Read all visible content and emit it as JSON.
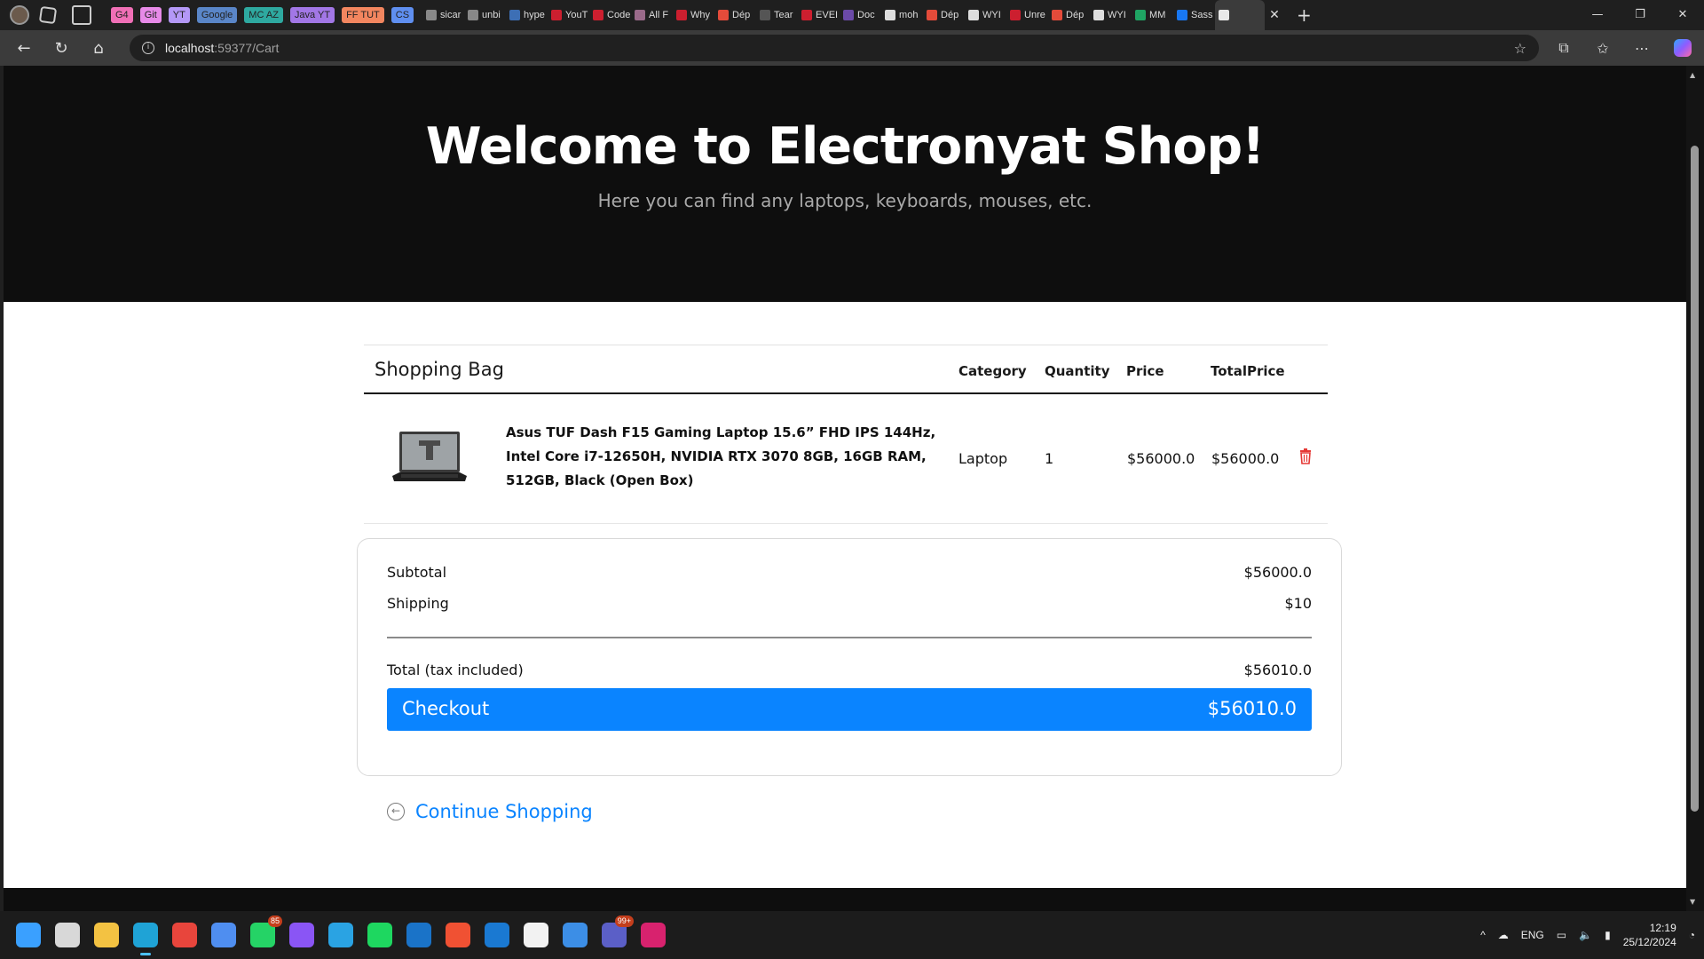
{
  "browser": {
    "tab_groups": [
      {
        "label": "G4",
        "color": "#f06fb6"
      },
      {
        "label": "Git",
        "color": "#e78ae8"
      },
      {
        "label": "YT",
        "color": "#b498f7"
      },
      {
        "label": "Google",
        "color": "#5a86c8"
      },
      {
        "label": "MC AZ",
        "color": "#2ea9a0"
      },
      {
        "label": "Java YT",
        "color": "#a277e6"
      },
      {
        "label": "FF TUT",
        "color": "#f2865f"
      },
      {
        "label": "CS",
        "color": "#5f8ff0"
      }
    ],
    "tabs": [
      {
        "title": "sicar",
        "favicon_color": "#888888"
      },
      {
        "title": "unbi",
        "favicon_color": "#888888"
      },
      {
        "title": "hype",
        "favicon_color": "#3d6fb5"
      },
      {
        "title": "YouT",
        "favicon_color": "#cc1f2f"
      },
      {
        "title": "Code",
        "favicon_color": "#cc1f2f"
      },
      {
        "title": "All F",
        "favicon_color": "#9a6a8a"
      },
      {
        "title": "Why",
        "favicon_color": "#cc1f2f"
      },
      {
        "title": "Dép",
        "favicon_color": "#e44b3a"
      },
      {
        "title": "Tear",
        "favicon_color": "#555555"
      },
      {
        "title": "EVEI",
        "favicon_color": "#cc1f2f"
      },
      {
        "title": "Doc",
        "favicon_color": "#6b4aa8"
      },
      {
        "title": "moh",
        "favicon_color": "#dddddd"
      },
      {
        "title": "Dép",
        "favicon_color": "#e44b3a"
      },
      {
        "title": "WYI",
        "favicon_color": "#dddddd"
      },
      {
        "title": "Unre",
        "favicon_color": "#cc1f2f"
      },
      {
        "title": "Dép",
        "favicon_color": "#e44b3a"
      },
      {
        "title": "WYI",
        "favicon_color": "#dddddd"
      },
      {
        "title": "MM",
        "favicon_color": "#1fa463"
      },
      {
        "title": "Sass",
        "favicon_color": "#1877f2"
      },
      {
        "title": "",
        "favicon_color": "#e8e8e8"
      }
    ],
    "url_host": "localhost",
    "url_path": ":59377/Cart"
  },
  "hero": {
    "title": "Welcome to Electronyat Shop!",
    "subtitle": "Here you can find any laptops, keyboards, mouses, etc."
  },
  "cart": {
    "heading": "Shopping Bag",
    "columns": {
      "category": "Category",
      "quantity": "Quantity",
      "price": "Price",
      "total": "TotalPrice"
    },
    "items": [
      {
        "name": "Asus TUF Dash F15 Gaming Laptop 15.6” FHD IPS 144Hz, Intel Core i7-12650H, NVIDIA RTX 3070 8GB, 16GB RAM, 512GB, Black (Open Box)",
        "category": "Laptop",
        "quantity": "1",
        "price": "$56000.0",
        "total": "$56000.0"
      }
    ]
  },
  "summary": {
    "subtotal_label": "Subtotal",
    "subtotal_value": "$56000.0",
    "shipping_label": "Shipping",
    "shipping_value": "$10",
    "total_label": "Total (tax included)",
    "total_value": "$56010.0",
    "checkout_label": "Checkout",
    "checkout_amount": "$56010.0"
  },
  "continue_label": "Continue Shopping",
  "taskbar": {
    "apps": [
      {
        "icon": "windows-start-icon",
        "color": "#3aa0ff"
      },
      {
        "icon": "task-view-icon",
        "color": "#d8d8d8"
      },
      {
        "icon": "file-explorer-icon",
        "color": "#f3c242"
      },
      {
        "icon": "edge-icon",
        "color": "#1fa3d6",
        "active": true
      },
      {
        "icon": "chrome-icon",
        "color": "#e8453c"
      },
      {
        "icon": "store-icon",
        "color": "#4f8ef0"
      },
      {
        "icon": "whatsapp-icon",
        "color": "#25d366",
        "badge": "85"
      },
      {
        "icon": "messenger-icon",
        "color": "#8a55f5"
      },
      {
        "icon": "telegram-icon",
        "color": "#2aa3e3"
      },
      {
        "icon": "spotify-icon",
        "color": "#1ed760"
      },
      {
        "icon": "outlook-icon",
        "color": "#1a73c8"
      },
      {
        "icon": "git-icon",
        "color": "#f05133"
      },
      {
        "icon": "trello-icon",
        "color": "#1a79d2"
      },
      {
        "icon": "notion-icon",
        "color": "#f2f2f2"
      },
      {
        "icon": "notes-icon",
        "color": "#3c8ee6"
      },
      {
        "icon": "teams-icon",
        "color": "#5b5fc7",
        "badge": "99+"
      },
      {
        "icon": "rider-icon",
        "color": "#d8226e"
      }
    ],
    "language": "ENG",
    "time": "12:19",
    "date": "25/12/2024"
  }
}
